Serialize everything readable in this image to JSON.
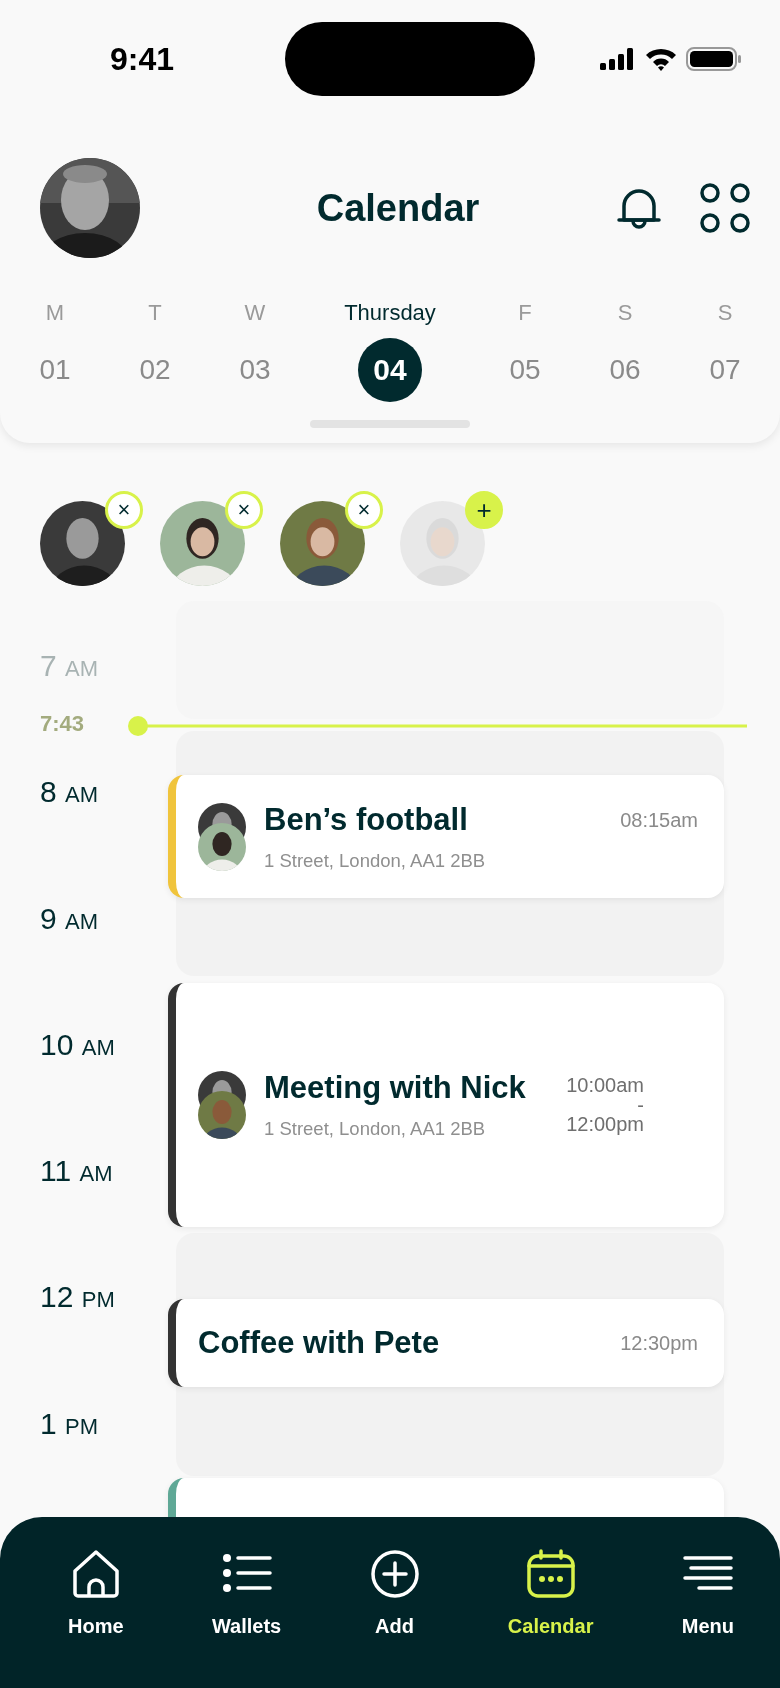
{
  "status_bar": {
    "time": "9:41"
  },
  "header": {
    "title": "Calendar"
  },
  "week": [
    {
      "day": "M",
      "date": "01",
      "selected": false
    },
    {
      "day": "T",
      "date": "02",
      "selected": false
    },
    {
      "day": "W",
      "date": "03",
      "selected": false
    },
    {
      "day": "Thursday",
      "date": "04",
      "selected": true
    },
    {
      "day": "F",
      "date": "05",
      "selected": false
    },
    {
      "day": "S",
      "date": "06",
      "selected": false
    },
    {
      "day": "S",
      "date": "07",
      "selected": false
    }
  ],
  "participants": [
    {
      "badge": "×",
      "added": true
    },
    {
      "badge": "×",
      "added": true
    },
    {
      "badge": "×",
      "added": true
    },
    {
      "badge": "+",
      "added": false
    }
  ],
  "timeline": {
    "now": "7:43",
    "hours": [
      {
        "hour": "7",
        "period": "AM",
        "past": true
      },
      {
        "hour": "8",
        "period": "AM",
        "past": false
      },
      {
        "hour": "9",
        "period": "AM",
        "past": false
      },
      {
        "hour": "10",
        "period": "AM",
        "past": false
      },
      {
        "hour": "11",
        "period": "AM",
        "past": false
      },
      {
        "hour": "12",
        "period": "PM",
        "past": false
      },
      {
        "hour": "1",
        "period": "PM",
        "past": false
      }
    ]
  },
  "events": [
    {
      "title": "Ben’s football",
      "address": "1 Street, London, AA1 2BB",
      "time": [
        "08:15am"
      ],
      "color": "#f0c43c",
      "attendees": [
        {
          "kind": "picture"
        },
        {
          "kind": "picture"
        }
      ]
    },
    {
      "title": "Meeting with Nick",
      "address": "1 Street, London, AA1 2BB",
      "time": [
        "10:00am",
        "-",
        "12:00pm"
      ],
      "color": "#333333",
      "attendees": [
        {
          "kind": "picture"
        },
        {
          "kind": "picture"
        }
      ]
    },
    {
      "title": "Coffee with Pete",
      "time": [
        "12:30pm"
      ],
      "color": "#333333"
    },
    {
      "color": "#5fa896"
    }
  ],
  "nav": [
    {
      "label": "Home",
      "selected": false
    },
    {
      "label": "Wallets",
      "selected": false
    },
    {
      "label": "Add",
      "selected": false
    },
    {
      "label": "Calendar",
      "selected": true
    },
    {
      "label": "Menu",
      "selected": false
    }
  ]
}
